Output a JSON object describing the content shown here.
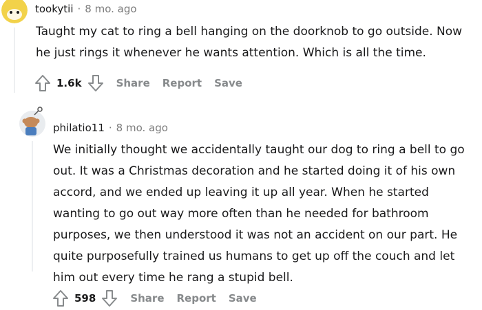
{
  "comments": [
    {
      "username": "tookytii",
      "separator": "·",
      "time": "8 mo. ago",
      "lines": [
        "Taught my cat to ring a bell hanging on the doorknob to go outside. Now",
        "he just rings it whenever he wants attention. Which is all the time."
      ],
      "score": "1.6k",
      "actions": {
        "share": "Share",
        "report": "Report",
        "save": "Save"
      }
    },
    {
      "username": "philatio11",
      "separator": "·",
      "time": "8 mo. ago",
      "lines": [
        "We initially thought we accidentally taught our dog to ring a bell to go",
        "out. It was a Christmas decoration and he started doing it of his own",
        "accord, and we ended up leaving it up all year. When he started",
        "wanting to go out way more often than he needed for bathroom",
        "purposes, we then understood it was not an accident on our part. He",
        "quite purposefully trained us humans to get up off the couch and let",
        "him out every time he rang a stupid bell."
      ],
      "score": "598",
      "actions": {
        "share": "Share",
        "report": "Report",
        "save": "Save"
      }
    }
  ],
  "colors": {
    "text": "#1a1a1b",
    "meta": "#7c7c7c",
    "action": "#878a8c",
    "avatar1_bg": "#f2d24a",
    "avatar2_bg": "#e9ecef"
  }
}
